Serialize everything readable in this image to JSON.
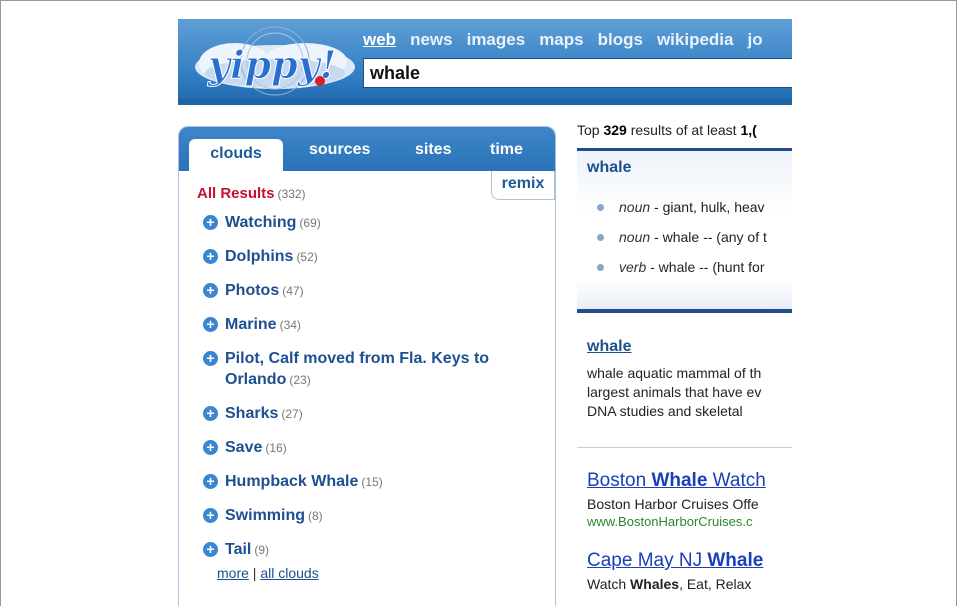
{
  "header": {
    "logo_text": "yippy!",
    "nav": [
      "web",
      "news",
      "images",
      "maps",
      "blogs",
      "wikipedia",
      "jo"
    ],
    "search_value": "whale"
  },
  "left_panel": {
    "tabs": [
      "clouds",
      "sources",
      "sites",
      "time"
    ],
    "remix_label": "remix",
    "all_results": {
      "label": "All Results",
      "count": "(332)"
    },
    "clusters": [
      {
        "label": "Watching",
        "count": "(69)"
      },
      {
        "label": "Dolphins",
        "count": "(52)"
      },
      {
        "label": "Photos",
        "count": "(47)"
      },
      {
        "label": "Marine",
        "count": "(34)"
      },
      {
        "label": "Pilot, Calf moved from Fla. Keys to Orlando",
        "count": "(23)"
      },
      {
        "label": "Sharks",
        "count": "(27)"
      },
      {
        "label": "Save",
        "count": "(16)"
      },
      {
        "label": "Humpback Whale",
        "count": "(15)"
      },
      {
        "label": "Swimming",
        "count": "(8)"
      },
      {
        "label": "Tail",
        "count": "(9)"
      }
    ],
    "more_link": "more",
    "separator": "|",
    "all_clouds_link": "all clouds"
  },
  "results": {
    "top_line_prefix": "Top ",
    "top_count": "329",
    "top_line_mid": " results of at least ",
    "top_min": "1,(",
    "definition": {
      "title": "whale",
      "senses": [
        {
          "pos": "noun",
          "text": " - giant, hulk, heav"
        },
        {
          "pos": "noun",
          "text": " - whale -- (any of t"
        },
        {
          "pos": "verb",
          "text": " - whale -- (hunt for"
        }
      ]
    },
    "wikipedia": {
      "title": "whale",
      "lines": [
        "whale aquatic mammal of th",
        "largest animals that have ev",
        "DNA studies and skeletal"
      ]
    },
    "ads": [
      {
        "title_pre": "Boston ",
        "title_bold": "Whale",
        "title_post": " Watch",
        "desc_pre": "Boston Harbor Cruises Offe",
        "desc_bold": "",
        "desc_post": "",
        "url": "www.BostonHarborCruises.c"
      },
      {
        "title_pre": "Cape May NJ ",
        "title_bold": "Whale",
        "title_post": "",
        "desc_pre": "Watch ",
        "desc_bold": "Whales",
        "desc_post": ", Eat, Relax"
      }
    ]
  }
}
